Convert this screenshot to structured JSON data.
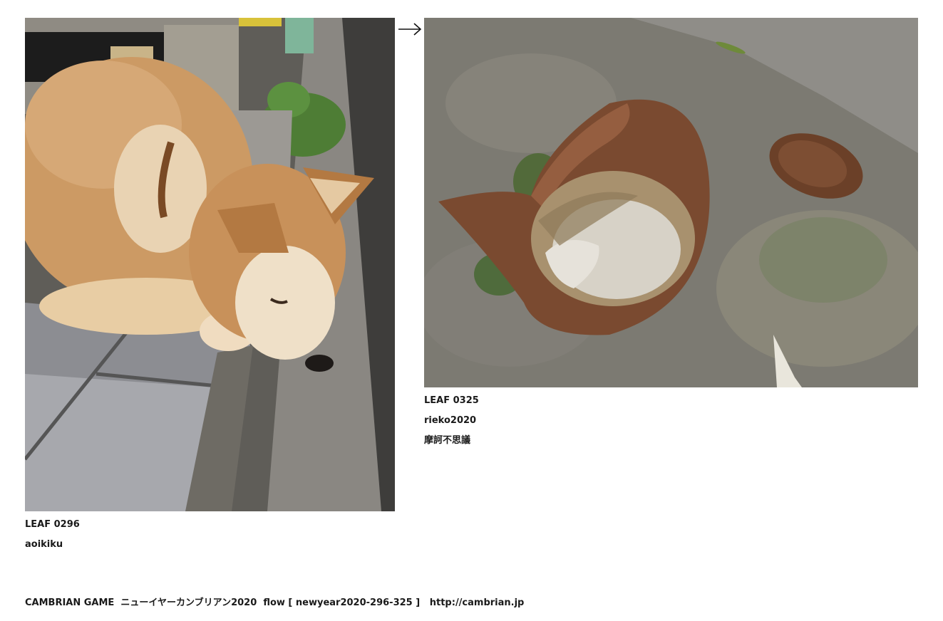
{
  "left_leaf": {
    "photo_subject": "shiba-dog-photo",
    "id_label": "LEAF 0296",
    "author": "aoikiku"
  },
  "right_leaf": {
    "photo_subject": "rusty-bowl-puddle-photo",
    "id_label": "LEAF 0325",
    "author": "rieko2020",
    "title": "摩訶不思議"
  },
  "next_arrow": {
    "icon": "arrow-right-icon",
    "glyph": "→"
  },
  "footer": {
    "game_name": "CAMBRIAN GAME",
    "event_name": "ニューイヤーカンブリアン2020",
    "flow_label": "flow [ newyear2020-296-325 ]",
    "site_url": "http://cambrian.jp"
  }
}
